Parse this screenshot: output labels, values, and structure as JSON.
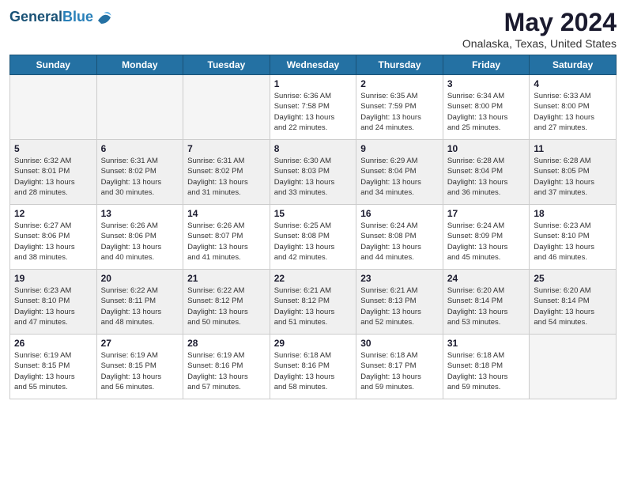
{
  "header": {
    "logo_line1": "General",
    "logo_line2": "Blue",
    "month_year": "May 2024",
    "location": "Onalaska, Texas, United States"
  },
  "weekdays": [
    "Sunday",
    "Monday",
    "Tuesday",
    "Wednesday",
    "Thursday",
    "Friday",
    "Saturday"
  ],
  "weeks": [
    [
      {
        "day": "",
        "info": "",
        "empty": true
      },
      {
        "day": "",
        "info": "",
        "empty": true
      },
      {
        "day": "",
        "info": "",
        "empty": true
      },
      {
        "day": "1",
        "info": "Sunrise: 6:36 AM\nSunset: 7:58 PM\nDaylight: 13 hours\nand 22 minutes.",
        "empty": false
      },
      {
        "day": "2",
        "info": "Sunrise: 6:35 AM\nSunset: 7:59 PM\nDaylight: 13 hours\nand 24 minutes.",
        "empty": false
      },
      {
        "day": "3",
        "info": "Sunrise: 6:34 AM\nSunset: 8:00 PM\nDaylight: 13 hours\nand 25 minutes.",
        "empty": false
      },
      {
        "day": "4",
        "info": "Sunrise: 6:33 AM\nSunset: 8:00 PM\nDaylight: 13 hours\nand 27 minutes.",
        "empty": false
      }
    ],
    [
      {
        "day": "5",
        "info": "Sunrise: 6:32 AM\nSunset: 8:01 PM\nDaylight: 13 hours\nand 28 minutes.",
        "empty": false
      },
      {
        "day": "6",
        "info": "Sunrise: 6:31 AM\nSunset: 8:02 PM\nDaylight: 13 hours\nand 30 minutes.",
        "empty": false
      },
      {
        "day": "7",
        "info": "Sunrise: 6:31 AM\nSunset: 8:02 PM\nDaylight: 13 hours\nand 31 minutes.",
        "empty": false
      },
      {
        "day": "8",
        "info": "Sunrise: 6:30 AM\nSunset: 8:03 PM\nDaylight: 13 hours\nand 33 minutes.",
        "empty": false
      },
      {
        "day": "9",
        "info": "Sunrise: 6:29 AM\nSunset: 8:04 PM\nDaylight: 13 hours\nand 34 minutes.",
        "empty": false
      },
      {
        "day": "10",
        "info": "Sunrise: 6:28 AM\nSunset: 8:04 PM\nDaylight: 13 hours\nand 36 minutes.",
        "empty": false
      },
      {
        "day": "11",
        "info": "Sunrise: 6:28 AM\nSunset: 8:05 PM\nDaylight: 13 hours\nand 37 minutes.",
        "empty": false
      }
    ],
    [
      {
        "day": "12",
        "info": "Sunrise: 6:27 AM\nSunset: 8:06 PM\nDaylight: 13 hours\nand 38 minutes.",
        "empty": false
      },
      {
        "day": "13",
        "info": "Sunrise: 6:26 AM\nSunset: 8:06 PM\nDaylight: 13 hours\nand 40 minutes.",
        "empty": false
      },
      {
        "day": "14",
        "info": "Sunrise: 6:26 AM\nSunset: 8:07 PM\nDaylight: 13 hours\nand 41 minutes.",
        "empty": false
      },
      {
        "day": "15",
        "info": "Sunrise: 6:25 AM\nSunset: 8:08 PM\nDaylight: 13 hours\nand 42 minutes.",
        "empty": false
      },
      {
        "day": "16",
        "info": "Sunrise: 6:24 AM\nSunset: 8:08 PM\nDaylight: 13 hours\nand 44 minutes.",
        "empty": false
      },
      {
        "day": "17",
        "info": "Sunrise: 6:24 AM\nSunset: 8:09 PM\nDaylight: 13 hours\nand 45 minutes.",
        "empty": false
      },
      {
        "day": "18",
        "info": "Sunrise: 6:23 AM\nSunset: 8:10 PM\nDaylight: 13 hours\nand 46 minutes.",
        "empty": false
      }
    ],
    [
      {
        "day": "19",
        "info": "Sunrise: 6:23 AM\nSunset: 8:10 PM\nDaylight: 13 hours\nand 47 minutes.",
        "empty": false
      },
      {
        "day": "20",
        "info": "Sunrise: 6:22 AM\nSunset: 8:11 PM\nDaylight: 13 hours\nand 48 minutes.",
        "empty": false
      },
      {
        "day": "21",
        "info": "Sunrise: 6:22 AM\nSunset: 8:12 PM\nDaylight: 13 hours\nand 50 minutes.",
        "empty": false
      },
      {
        "day": "22",
        "info": "Sunrise: 6:21 AM\nSunset: 8:12 PM\nDaylight: 13 hours\nand 51 minutes.",
        "empty": false
      },
      {
        "day": "23",
        "info": "Sunrise: 6:21 AM\nSunset: 8:13 PM\nDaylight: 13 hours\nand 52 minutes.",
        "empty": false
      },
      {
        "day": "24",
        "info": "Sunrise: 6:20 AM\nSunset: 8:14 PM\nDaylight: 13 hours\nand 53 minutes.",
        "empty": false
      },
      {
        "day": "25",
        "info": "Sunrise: 6:20 AM\nSunset: 8:14 PM\nDaylight: 13 hours\nand 54 minutes.",
        "empty": false
      }
    ],
    [
      {
        "day": "26",
        "info": "Sunrise: 6:19 AM\nSunset: 8:15 PM\nDaylight: 13 hours\nand 55 minutes.",
        "empty": false
      },
      {
        "day": "27",
        "info": "Sunrise: 6:19 AM\nSunset: 8:15 PM\nDaylight: 13 hours\nand 56 minutes.",
        "empty": false
      },
      {
        "day": "28",
        "info": "Sunrise: 6:19 AM\nSunset: 8:16 PM\nDaylight: 13 hours\nand 57 minutes.",
        "empty": false
      },
      {
        "day": "29",
        "info": "Sunrise: 6:18 AM\nSunset: 8:16 PM\nDaylight: 13 hours\nand 58 minutes.",
        "empty": false
      },
      {
        "day": "30",
        "info": "Sunrise: 6:18 AM\nSunset: 8:17 PM\nDaylight: 13 hours\nand 59 minutes.",
        "empty": false
      },
      {
        "day": "31",
        "info": "Sunrise: 6:18 AM\nSunset: 8:18 PM\nDaylight: 13 hours\nand 59 minutes.",
        "empty": false
      },
      {
        "day": "",
        "info": "",
        "empty": true
      }
    ]
  ]
}
